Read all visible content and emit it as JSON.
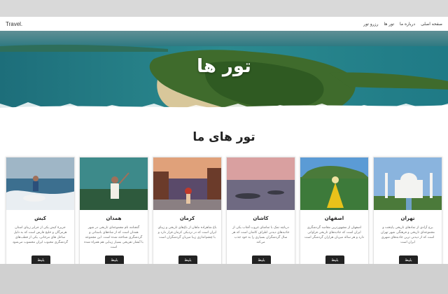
{
  "nav": {
    "brand": "Travel.",
    "links": [
      "صفحه اصلی",
      "درباره ما",
      "تور ها",
      "رزرو تور"
    ]
  },
  "hero": {
    "title": "تور ها"
  },
  "section": {
    "title": "تور های ما"
  },
  "cards": [
    {
      "title": "کیش",
      "desc": "جزیرهٔ کیش یکی از جزایر زیبای استان هرمزگان و خلیج فارس است که به دلیل ساحل های مرجانی، یکی از قطب‌های گردشگری محبوب ایران محسوب می‌شود",
      "button": "بلیط"
    },
    {
      "title": "همدان",
      "desc": "گنجنامه نام مجموعه‌ای تاریخی در شهر همدان است که از شاه‌های باستانی و گردشگری شناخته شده است. این مجموعه با آبشار تفریحی بسیار زیبایی هم همراه شده است",
      "button": "بلیط"
    },
    {
      "title": "کرمان",
      "desc": "باغ شاهزاده ماهان از باغ‌های تاریخی و زیبای ایران است که در نزدیکی کرمان قرار دارد و با چشم‌اندازی زیبا میزبان گردشگران است",
      "button": "بلیط"
    },
    {
      "title": "کاشان",
      "desc": "دریاچه نمک با تماشای غروب آفتاب یکی از جاذبه‌های دیدنی اطراف کاشان است که هر سال گردشگران بسیاری را به خود جذب می‌کند",
      "button": "بلیط"
    },
    {
      "title": "اصفهان",
      "desc": "اصفهان از مشهورترین مقاصد گردشگری ایران است که جاذبه‌های تاریخی فراوانی دارد و هر ساله میزبان هزاران گردشگر است",
      "button": "بلیط"
    },
    {
      "title": "تهران",
      "desc": "برج آزادی از نمادهای تاریخی پایتخت و مجموعه‌ای تاریخی و فرهنگی شهر تهران است که از دیدنی ترین جاذبه‌های شهری ایران است",
      "button": "بلیط"
    }
  ]
}
